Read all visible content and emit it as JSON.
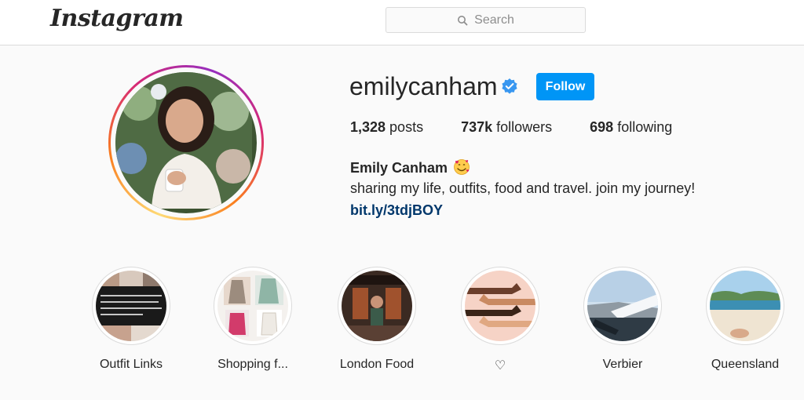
{
  "header": {
    "logo": "Instagram",
    "search_placeholder": "Search"
  },
  "profile": {
    "username": "emilycanham",
    "follow_label": "Follow",
    "stats": {
      "posts_count": "1,328",
      "posts_label": " posts",
      "followers_count": "737k",
      "followers_label": " followers",
      "following_count": "698",
      "following_label": " following"
    },
    "full_name": "Emily Canham",
    "bio": "sharing my life, outfits, food and travel. join my journey!",
    "link": "bit.ly/3tdjBOY",
    "link_color": "#00376b",
    "follow_color": "#0095f6",
    "verified_color": "#3897f0"
  },
  "highlights": [
    {
      "label": "Outfit Links",
      "icon": "outfit-collage"
    },
    {
      "label": "Shopping f...",
      "icon": "shopping-collage"
    },
    {
      "label": "London Food",
      "icon": "restaurant-photo"
    },
    {
      "label": "♡",
      "icon": "hands-illustration"
    },
    {
      "label": "Verbier",
      "icon": "airplane-window"
    },
    {
      "label": "Queensland",
      "icon": "beach-photo"
    }
  ]
}
